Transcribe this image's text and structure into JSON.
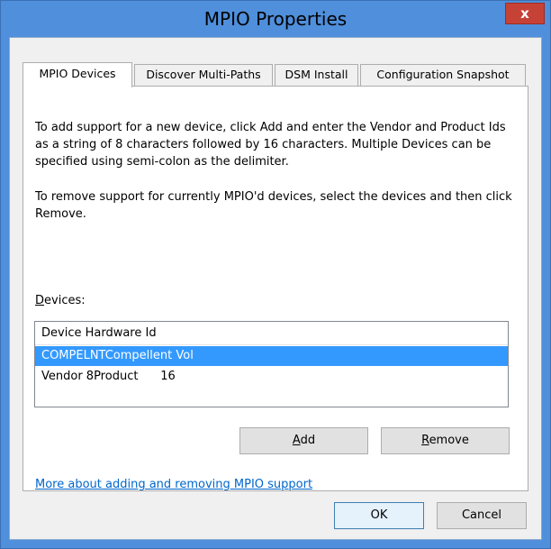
{
  "window": {
    "title": "MPIO Properties",
    "close_glyph": "x"
  },
  "tabs": [
    {
      "label": "MPIO Devices",
      "active": true
    },
    {
      "label": "Discover Multi-Paths",
      "active": false
    },
    {
      "label": "DSM Install",
      "active": false
    },
    {
      "label": "Configuration Snapshot",
      "active": false
    }
  ],
  "panel": {
    "add_instructions": "To add support for a new device, click Add and enter the Vendor and Product Ids as a string of 8 characters followed by 16 characters. Multiple Devices can be specified using semi-colon as the delimiter.",
    "remove_instructions": "To remove support for currently MPIO'd devices, select the devices and then click Remove.",
    "devices_label_first": "D",
    "devices_label_rest": "evices:",
    "devices_list": {
      "header": "Device Hardware Id",
      "rows": [
        {
          "text": "COMPELNTCompellent Vol",
          "selected": true
        },
        {
          "text": "Vendor 8Product      16",
          "selected": false
        }
      ]
    },
    "add_button_first": "A",
    "add_button_rest": "dd",
    "remove_button_first": "R",
    "remove_button_rest": "emove",
    "help_link": "More about adding and removing MPIO support"
  },
  "footer": {
    "ok_label": "OK",
    "cancel_label": "Cancel"
  },
  "colors": {
    "title_bar": "#4f8fdb",
    "close_button": "#c74236",
    "selection": "#3399ff",
    "link": "#0066cc"
  }
}
